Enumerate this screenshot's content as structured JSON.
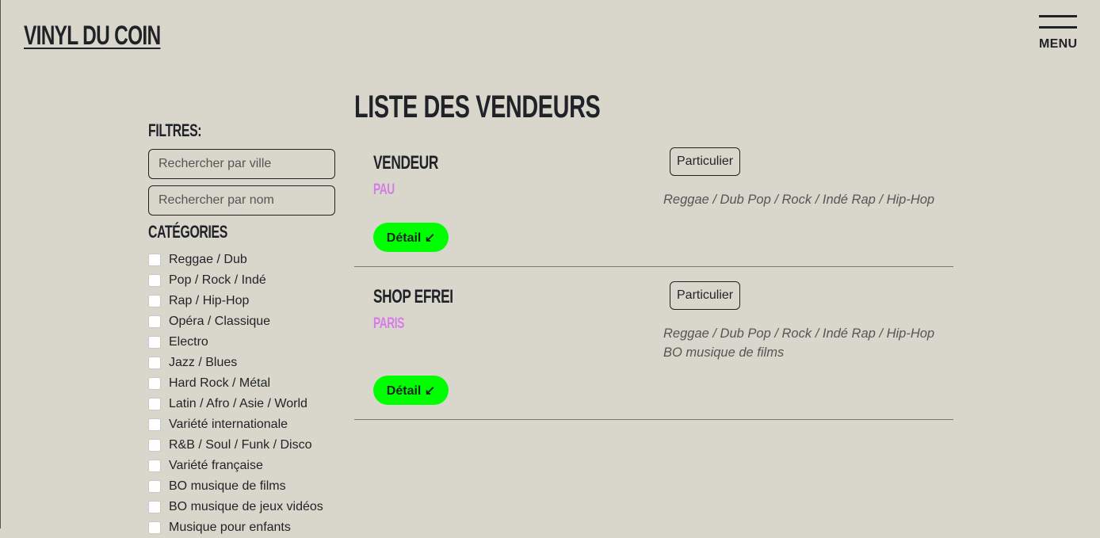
{
  "header": {
    "brand": "VINYL DU COIN",
    "menu_label": "MENU"
  },
  "filters": {
    "title": "FILTRES:",
    "city_placeholder": "Rechercher par ville",
    "name_placeholder": "Rechercher par nom",
    "categories_title": "CATÉGORIES",
    "categories": [
      "Reggae / Dub",
      "Pop / Rock / Indé",
      "Rap / Hip-Hop",
      "Opéra / Classique",
      "Electro",
      "Jazz / Blues",
      "Hard Rock / Métal",
      "Latin / Afro / Asie / World",
      "Variété internationale",
      "R&B / Soul / Funk / Disco",
      "Variété française",
      "BO musique de films",
      "BO musique de jeux vidéos",
      "Musique pour enfants"
    ]
  },
  "main": {
    "title": "LISTE DES VENDEURS",
    "sellers": [
      {
        "name": "VENDEUR",
        "city": "PAU",
        "type": "Particulier",
        "genres_line1": "Reggae / Dub Pop / Rock / Indé Rap / Hip-Hop",
        "genres_line2": "",
        "detail_label": "Détail ↙"
      },
      {
        "name": "SHOP EFREI",
        "city": "PARIS",
        "type": "Particulier",
        "genres_line1": "Reggae / Dub Pop / Rock / Indé Rap / Hip-Hop",
        "genres_line2": "BO musique de films",
        "detail_label": "Détail ↙"
      }
    ]
  },
  "colors": {
    "background": "#d9d7cb",
    "accent_green": "#00ff00",
    "city_pink": "#d77ce6",
    "text": "#1f2328"
  }
}
